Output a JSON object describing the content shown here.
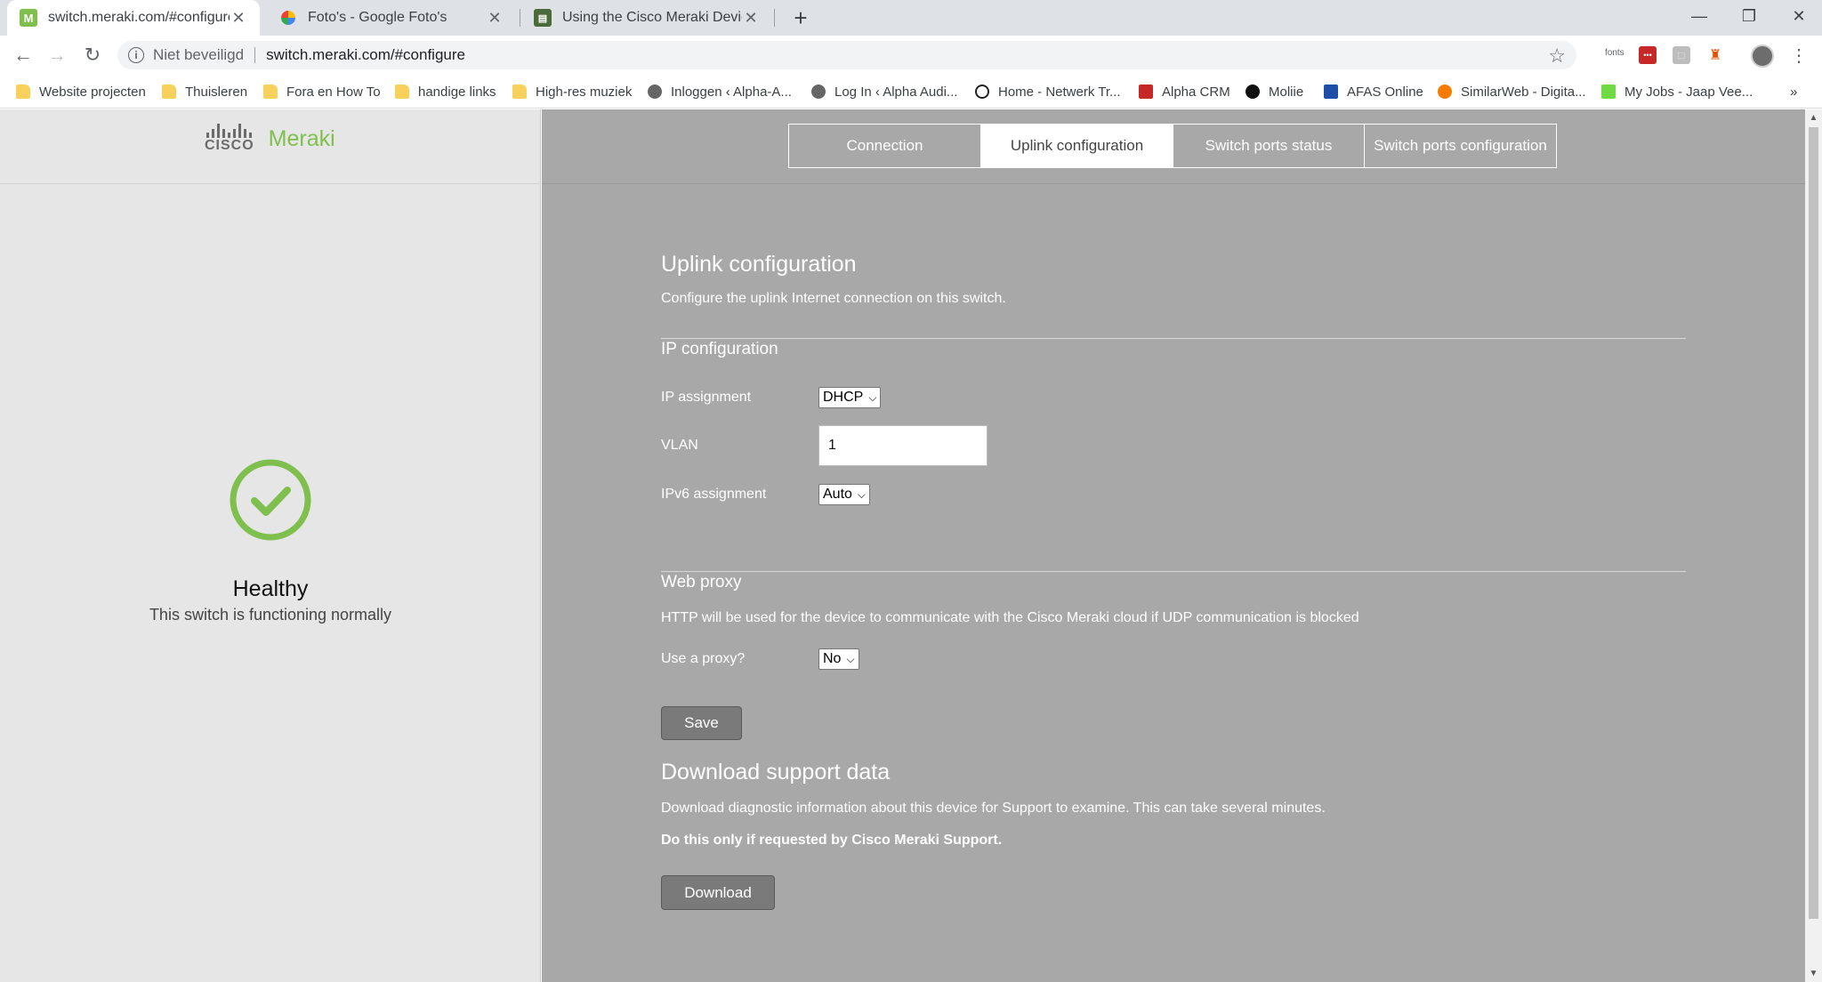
{
  "browser": {
    "tabs": [
      {
        "title": "switch.meraki.com/#configure",
        "active": true
      },
      {
        "title": "Foto's - Google Foto's",
        "active": false
      },
      {
        "title": "Using the Cisco Meraki Device Lo",
        "active": false
      }
    ],
    "new_tab": "+",
    "address": {
      "security_label": "Niet beveiligd",
      "url": "switch.meraki.com/#configure"
    },
    "extensions": [
      "fonts"
    ],
    "bookmarks": [
      {
        "label": "Website projecten",
        "icon": "folder-icon"
      },
      {
        "label": "Thuisleren",
        "icon": "folder-icon"
      },
      {
        "label": "Fora en How To",
        "icon": "folder-icon"
      },
      {
        "label": "handige links",
        "icon": "folder-icon"
      },
      {
        "label": "High-res muziek",
        "icon": "folder-icon"
      },
      {
        "label": "Inloggen ‹ Alpha-A...",
        "icon": "site-icon"
      },
      {
        "label": "Log In ‹ Alpha Audi...",
        "icon": "site-icon"
      },
      {
        "label": "Home - Netwerk Tr...",
        "icon": "power-icon"
      },
      {
        "label": "Alpha CRM",
        "icon": "flag-icon"
      },
      {
        "label": "Moliie",
        "icon": "m-icon"
      },
      {
        "label": "AFAS Online",
        "icon": "afas-icon"
      },
      {
        "label": "SimilarWeb - Digita...",
        "icon": "similarweb-icon"
      },
      {
        "label": "My Jobs - Jaap Vee...",
        "icon": "upwork-icon"
      }
    ],
    "bookmarks_overflow": "»"
  },
  "sidebar": {
    "logo_cisco": "CISCO",
    "logo_meraki": "Meraki",
    "health_status": "Healthy",
    "health_description": "This switch is functioning normally",
    "health_color": "#7fbf4d"
  },
  "nav": {
    "tabs": [
      {
        "label": "Connection"
      },
      {
        "label": "Uplink configuration"
      },
      {
        "label": "Switch ports status"
      },
      {
        "label": "Switch ports configuration"
      }
    ],
    "active": "Uplink configuration"
  },
  "uplink": {
    "title": "Uplink configuration",
    "description": "Configure the uplink Internet connection on this switch.",
    "ip_section": "IP configuration",
    "ip_assignment_label": "IP assignment",
    "ip_assignment_value": "DHCP",
    "vlan_label": "VLAN",
    "vlan_value": "1",
    "ipv6_label": "IPv6 assignment",
    "ipv6_value": "Auto",
    "proxy_section": "Web proxy",
    "proxy_description": "HTTP will be used for the device to communicate with the Cisco Meraki cloud if UDP communication is blocked",
    "proxy_label": "Use a proxy?",
    "proxy_value": "No",
    "save_label": "Save"
  },
  "support": {
    "title": "Download support data",
    "description": "Download diagnostic information about this device for Support to examine. This can take several minutes.",
    "note": "Do this only if requested by Cisco Meraki Support.",
    "download_label": "Download"
  }
}
